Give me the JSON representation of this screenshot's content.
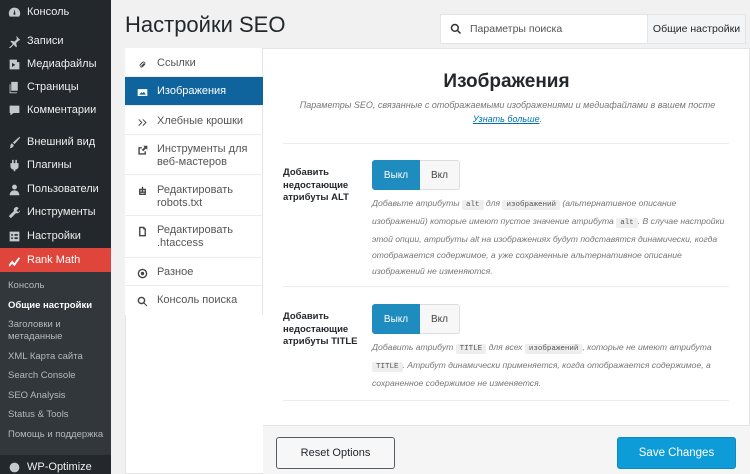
{
  "wp_menu": [
    {
      "label": "Консоль",
      "icon": "dashboard-icon"
    },
    {
      "label": "Записи",
      "icon": "pin-icon"
    },
    {
      "label": "Медиафайлы",
      "icon": "media-icon"
    },
    {
      "label": "Страницы",
      "icon": "pages-icon"
    },
    {
      "label": "Комментарии",
      "icon": "comments-icon"
    },
    {
      "label": "Внешний вид",
      "icon": "brush-icon"
    },
    {
      "label": "Плагины",
      "icon": "plugin-icon"
    },
    {
      "label": "Пользователи",
      "icon": "users-icon"
    },
    {
      "label": "Инструменты",
      "icon": "tools-icon"
    },
    {
      "label": "Настройки",
      "icon": "settings-icon"
    },
    {
      "label": "Rank Math",
      "icon": "rankmath-icon"
    }
  ],
  "rank_math_submenu": [
    "Консоль",
    "Общие настройки",
    "Заголовки и метаданные",
    "XML Карта сайта",
    "Search Console",
    "SEO Analysis",
    "Status & Tools",
    "Помощь и поддержка"
  ],
  "wp_optimize_label": "WP-Optimize",
  "page_title": "Настройки SEO",
  "search": {
    "placeholder": "Параметры поиска",
    "scope": "Общие настройки"
  },
  "settings_nav": [
    {
      "label": "Ссылки",
      "icon": "link-icon"
    },
    {
      "label": "Изображения",
      "icon": "image-icon"
    },
    {
      "label": "Хлебные крошки",
      "icon": "double-chevron-icon"
    },
    {
      "label": "Инструменты для веб-мастеров",
      "icon": "external-link-icon"
    },
    {
      "label": "Редактировать robots.txt",
      "icon": "robot-icon"
    },
    {
      "label": "Редактировать .htaccess",
      "icon": "file-icon"
    },
    {
      "label": "Разное",
      "icon": "circle-dot-icon"
    },
    {
      "label": "Консоль поиска",
      "icon": "search-icon"
    }
  ],
  "section": {
    "title": "Изображения",
    "description": "Параметры SEO, связанные с отображаемыми изображениями и медиафайлами в вашем посте",
    "learn_more": "Узнать больше",
    "learn_more_suffix": "."
  },
  "fields": [
    {
      "label": "Добавить недостающие атрибуты ALT",
      "on_label": "Выкл",
      "off_label": "Вкл",
      "desc_parts": {
        "p1": "Добавьте атрибуты",
        "code1": "alt",
        "p2": "для",
        "code2": "изображений",
        "p3": "(альтернативное описание изображений) которые имеют пустое значение атрибута",
        "code3": "alt",
        "p4": ". В случае настройки этой опции, атрибуты alt на изображениях будут подставятся динамически, когда отображается содержимое, а уже сохраненные альтернативное описание изображений не изменяются."
      }
    },
    {
      "label": "Добавить недостающие атрибуты TITLE",
      "on_label": "Выкл",
      "off_label": "Вкл",
      "desc_parts": {
        "p1": "Добавить атрибут",
        "code1": "TITLE",
        "p2": "для всех",
        "code2": "изображений",
        "p3": ", которые не имеют атрибута",
        "code3": "TITLE",
        "p4": ". Атрибут динамически применяется, когда отображается содержимое, а сохраненное содержимое не изменяется."
      }
    }
  ],
  "footer": {
    "reset": "Reset Options",
    "save": "Save Changes"
  },
  "colors": {
    "wp_sidebar": "#23282d",
    "rank_math_active": "#e0453c",
    "nav_active": "#10649e",
    "toggle_on": "#1e8cbe",
    "save_button": "#0e9cd8"
  }
}
